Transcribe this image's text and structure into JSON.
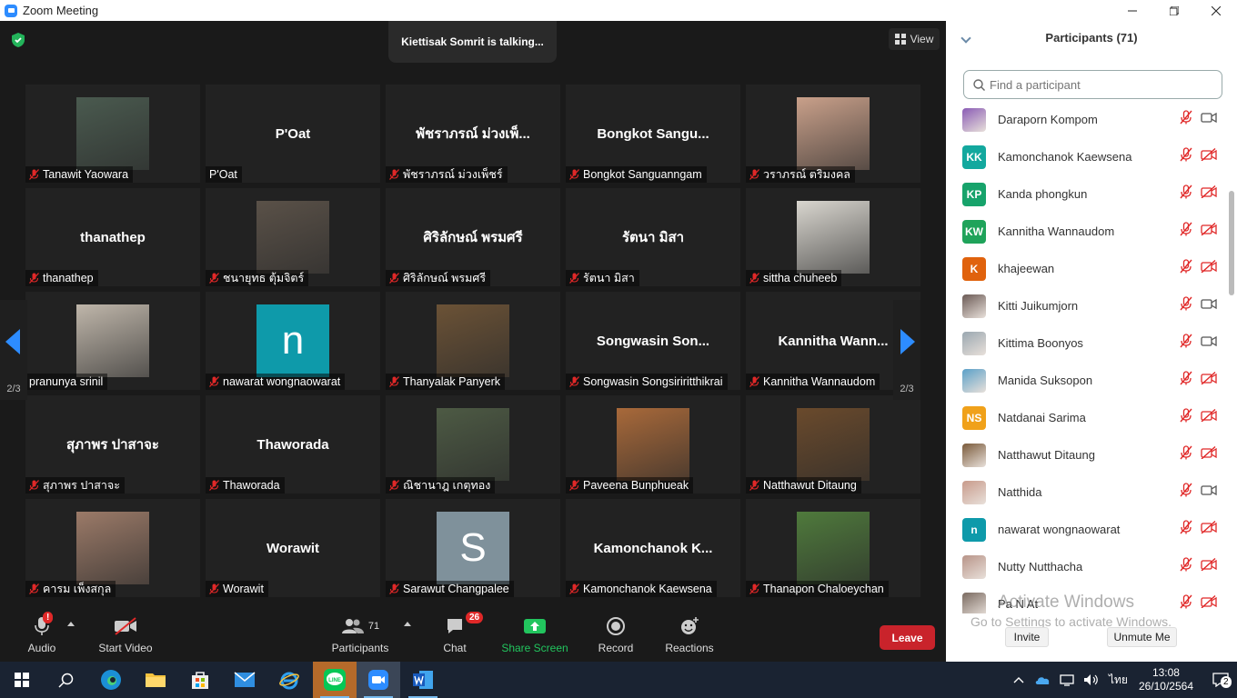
{
  "window": {
    "title": "Zoom Meeting"
  },
  "stage": {
    "talking_banner": "Kiettisak Somrit is talking...",
    "view_label": "View",
    "page_left": "2/3",
    "page_right": "2/3"
  },
  "tiles": [
    {
      "label": "Tanawit Yaowara",
      "muted": true,
      "kind": "photo",
      "pic": "#4a5a4f"
    },
    {
      "label": "P'Oat",
      "muted": false,
      "kind": "name",
      "display": "P'Oat"
    },
    {
      "label": "พัชราภรณ์ ม่วงเพ็ชร์",
      "muted": true,
      "kind": "name",
      "display": "พัชราภรณ์ ม่วงเพ็..."
    },
    {
      "label": "Bongkot Sanguanngam",
      "muted": true,
      "kind": "name",
      "display": "Bongkot  Sangu..."
    },
    {
      "label": "วราภรณ์ ตริมงคล",
      "muted": true,
      "kind": "photo",
      "pic": "#c9a08a"
    },
    {
      "label": "thanathep",
      "muted": true,
      "kind": "name",
      "display": "thanathep"
    },
    {
      "label": "ชนายุทธ ตุ้มจิตร์",
      "muted": true,
      "kind": "photo",
      "pic": "#5a5148"
    },
    {
      "label": "ศิริลักษณ์ พรมศรี",
      "muted": true,
      "kind": "name",
      "display": "ศิริลักษณ์ พรมศรี"
    },
    {
      "label": "รัตนา มิสา",
      "muted": true,
      "kind": "name",
      "display": "รัตนา มิสา"
    },
    {
      "label": "sittha chuheeb",
      "muted": true,
      "kind": "photo",
      "pic": "#d9d6cf"
    },
    {
      "label": "pranunya srinil",
      "muted": false,
      "kind": "photo",
      "pic": "#bfb6aa"
    },
    {
      "label": "nawarat wongnaowarat",
      "muted": true,
      "kind": "initial",
      "display": "n",
      "pic": "#0e9aaa"
    },
    {
      "label": "Thanyalak Panyerk",
      "muted": true,
      "kind": "photo",
      "pic": "#6b5236"
    },
    {
      "label": "Songwasin Songsiriritthikrai",
      "muted": true,
      "kind": "name",
      "display": "Songwasin  Son..."
    },
    {
      "label": "Kannitha Wannaudom",
      "muted": true,
      "kind": "name",
      "display": "Kannitha  Wann..."
    },
    {
      "label": "สุภาพร ปาสาจะ",
      "muted": true,
      "kind": "name",
      "display": "สุภาพร ปาสาจะ"
    },
    {
      "label": "Thaworada",
      "muted": true,
      "kind": "name",
      "display": "Thaworada"
    },
    {
      "label": "ณิชานาฎ เกตุทอง",
      "muted": true,
      "kind": "photo",
      "pic": "#4d5a44"
    },
    {
      "label": "Paveena Bunphueak",
      "muted": true,
      "kind": "photo",
      "pic": "#a8693a"
    },
    {
      "label": "Natthawut Ditaung",
      "muted": true,
      "kind": "photo",
      "pic": "#6a4a2c"
    },
    {
      "label": "คารม เพ็งสกุล",
      "muted": true,
      "kind": "photo",
      "pic": "#9b7a68"
    },
    {
      "label": "Worawit",
      "muted": true,
      "kind": "name",
      "display": "Worawit"
    },
    {
      "label": "Sarawut Changpalee",
      "muted": true,
      "kind": "initial",
      "display": "S",
      "pic": "#7f919b"
    },
    {
      "label": "Kamonchanok Kaewsena",
      "muted": true,
      "kind": "name",
      "display": "Kamonchanok  K..."
    },
    {
      "label": "Thanapon Chaloeychan",
      "muted": true,
      "kind": "photo",
      "pic": "#4f7a3c"
    }
  ],
  "toolbar": {
    "audio": "Audio",
    "audio_alert": "!",
    "start_video": "Start Video",
    "participants": "Participants",
    "participants_count": "71",
    "chat": "Chat",
    "chat_badge": "26",
    "share_screen": "Share Screen",
    "record": "Record",
    "reactions": "Reactions",
    "leave": "Leave"
  },
  "panel": {
    "title": "Participants (71)",
    "search_placeholder": "Find a participant",
    "invite": "Invite",
    "unmute_me": "Unmute Me",
    "participants": [
      {
        "name": "Daraporn Kompom",
        "avatar": "",
        "color": "#8a5bb5",
        "cam_off": false
      },
      {
        "name": "Kamonchanok Kaewsena",
        "avatar": "KK",
        "color": "#13a89e",
        "cam_off": true
      },
      {
        "name": "Kanda phongkun",
        "avatar": "KP",
        "color": "#17a36b",
        "cam_off": true
      },
      {
        "name": "Kannitha Wannaudom",
        "avatar": "KW",
        "color": "#1fa35a",
        "cam_off": true
      },
      {
        "name": "khajeewan",
        "avatar": "K",
        "color": "#e0620d",
        "cam_off": true
      },
      {
        "name": "Kitti Juikumjorn",
        "avatar": "",
        "color": "#6b5a55",
        "cam_off": false
      },
      {
        "name": "Kittima Boonyos",
        "avatar": "",
        "color": "#9aa7b0",
        "cam_off": false
      },
      {
        "name": "Manida Suksopon",
        "avatar": "",
        "color": "#5aa0c8",
        "cam_off": true
      },
      {
        "name": "Natdanai Sarima",
        "avatar": "NS",
        "color": "#f0a11a",
        "cam_off": true
      },
      {
        "name": "Natthawut Ditaung",
        "avatar": "",
        "color": "#7a5a3a",
        "cam_off": true
      },
      {
        "name": "Natthida",
        "avatar": "",
        "color": "#c89a8a",
        "cam_off": false
      },
      {
        "name": "nawarat wongnaowarat",
        "avatar": "n",
        "color": "#0e9aaa",
        "cam_off": true
      },
      {
        "name": "Nutty Nutthacha",
        "avatar": "",
        "color": "#b89488",
        "cam_off": true
      },
      {
        "name": "Pa N At",
        "avatar": "",
        "color": "#7a6a60",
        "cam_off": true
      }
    ]
  },
  "watermark": {
    "line1": "Activate Windows",
    "line2": "Go to Settings to activate Windows."
  },
  "taskbar": {
    "lang": "ไทย",
    "time": "13:08",
    "date": "26/10/2564",
    "notif_count": "2",
    "line_label": "LINE"
  },
  "colors": {
    "accent": "#2d8cff",
    "mute_red": "#e02828",
    "share_green": "#22c55e",
    "leave_red": "#c9232b"
  }
}
